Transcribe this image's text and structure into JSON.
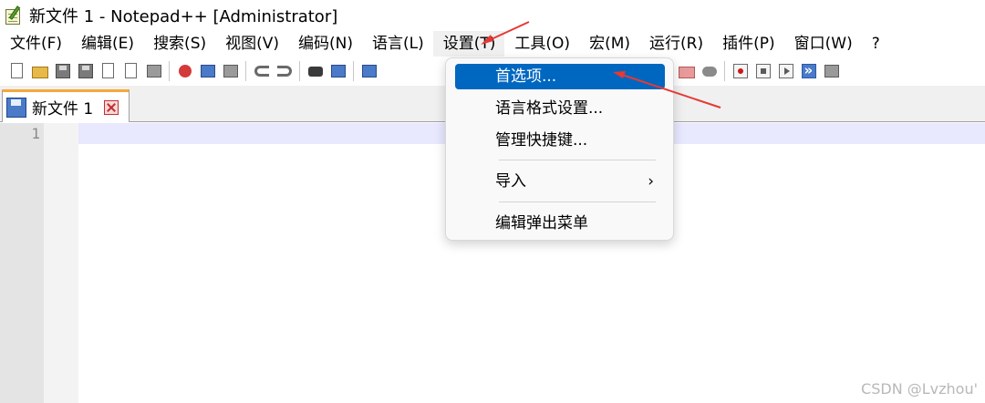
{
  "window": {
    "title": "新文件 1 - Notepad++ [Administrator]"
  },
  "menubar": {
    "items": [
      "文件(F)",
      "编辑(E)",
      "搜索(S)",
      "视图(V)",
      "编码(N)",
      "语言(L)",
      "设置(T)",
      "工具(O)",
      "宏(M)",
      "运行(R)",
      "插件(P)",
      "窗口(W)",
      "?"
    ]
  },
  "toolbar": {
    "icons": [
      "new-file-icon",
      "open-folder-icon",
      "save-icon",
      "save-all-icon",
      "close-icon",
      "close-all-icon",
      "print-icon",
      "cut-icon",
      "copy-icon",
      "paste-icon",
      "undo-icon",
      "redo-icon",
      "find-icon",
      "replace-icon",
      "zoom-icon",
      "wrap-icon",
      "sync-icon",
      "doc-map-icon",
      "function-list-icon",
      "record-macro-icon",
      "stop-macro-icon",
      "play-macro-icon",
      "run-macro-multiple-icon",
      "save-macro-icon"
    ]
  },
  "tabs": [
    {
      "label": "新文件 1"
    }
  ],
  "editor": {
    "line_numbers": [
      "1"
    ]
  },
  "settings_menu": {
    "items": [
      {
        "label": "首选项...",
        "highlighted": true
      },
      {
        "label": "语言格式设置..."
      },
      {
        "label": "管理快捷键..."
      },
      {
        "label": "导入",
        "submenu_arrow": "›"
      },
      {
        "label": "编辑弹出菜单"
      }
    ]
  },
  "watermark": "CSDN @Lvzhou'",
  "colors": {
    "highlight": "#0067c0",
    "tab_accent": "#f7a83a",
    "annotation_arrow": "#e53935",
    "current_line": "#e8e8ff"
  }
}
